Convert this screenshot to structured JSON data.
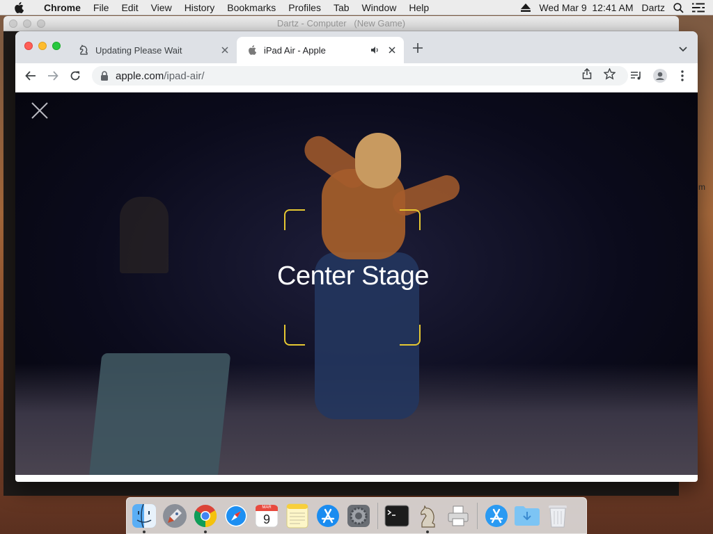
{
  "menubar": {
    "app_name": "Chrome",
    "menus": [
      "File",
      "Edit",
      "View",
      "History",
      "Bookmarks",
      "Profiles",
      "Tab",
      "Window",
      "Help"
    ],
    "datetime": "Wed Mar 9  12:41 AM",
    "user": "Dartz"
  },
  "background_window": {
    "title": "Dartz - Computer   (New Game)",
    "side_text": "m"
  },
  "browser": {
    "tabs": [
      {
        "title": "Updating Please Wait",
        "active": false,
        "playing_audio": false
      },
      {
        "title": "iPad Air - Apple",
        "active": true,
        "playing_audio": true
      }
    ],
    "url_host": "apple.com",
    "url_path": "/ipad-air/"
  },
  "page": {
    "headline": "Center Stage"
  },
  "dock": {
    "apps": [
      {
        "name": "Finder",
        "icon": "finder-icon",
        "running": true
      },
      {
        "name": "Launchpad",
        "icon": "launchpad-icon",
        "running": false
      },
      {
        "name": "Google Chrome",
        "icon": "chrome-icon",
        "running": true
      },
      {
        "name": "Safari",
        "icon": "safari-icon",
        "running": false
      },
      {
        "name": "Calendar",
        "icon": "calendar-icon",
        "running": false,
        "month": "MAR",
        "day": "9"
      },
      {
        "name": "Notes",
        "icon": "notes-icon",
        "running": false
      },
      {
        "name": "App Store",
        "icon": "app-store-icon",
        "running": false
      },
      {
        "name": "System Preferences",
        "icon": "system-preferences-icon",
        "running": false
      },
      {
        "name": "Terminal",
        "icon": "terminal-icon",
        "running": false
      },
      {
        "name": "Chess",
        "icon": "chess-icon",
        "running": true
      },
      {
        "name": "Printer",
        "icon": "printer-icon",
        "running": false
      },
      {
        "name": "Applications",
        "icon": "applications-folder-icon",
        "running": false
      },
      {
        "name": "Downloads",
        "icon": "downloads-folder-icon",
        "running": false
      },
      {
        "name": "Trash",
        "icon": "trash-icon",
        "running": false
      }
    ]
  },
  "colors": {
    "center_stage_bracket": "#e6c832",
    "tab_strip": "#dee1e6",
    "omnibox": "#f1f3f4"
  }
}
